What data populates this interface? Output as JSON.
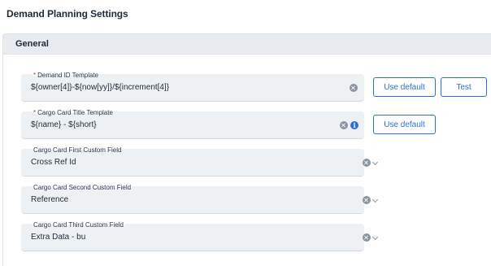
{
  "page": {
    "title": "Demand Planning Settings"
  },
  "section": {
    "title": "General"
  },
  "fields": {
    "demand_id_template": {
      "label": "Demand ID Template",
      "required_mark": "*",
      "value": "${owner[4]}-${now[yy]}/${increment[4]}"
    },
    "cargo_card_title_template": {
      "label": "Cargo Card Title Template",
      "required_mark": "*",
      "value": "${name} - ${short}"
    },
    "cargo_card_first_custom_field": {
      "label": "Cargo Card First Custom Field",
      "value": "Cross Ref Id"
    },
    "cargo_card_second_custom_field": {
      "label": "Cargo Card Second Custom Field",
      "value": "Reference"
    },
    "cargo_card_third_custom_field": {
      "label": "Cargo Card Third Custom Field",
      "value": "Extra Data - bu"
    }
  },
  "buttons": {
    "use_default_1": "Use default",
    "test": "Test",
    "use_default_2": "Use default"
  },
  "icons": {
    "clear": "clear-icon",
    "info": "info-icon",
    "dropdown": "chevron-down-icon"
  },
  "colors": {
    "accent": "#2d6fde",
    "required": "#d32f2f",
    "field_bg": "#eef1f4",
    "header_bg": "#e8ecf1"
  }
}
